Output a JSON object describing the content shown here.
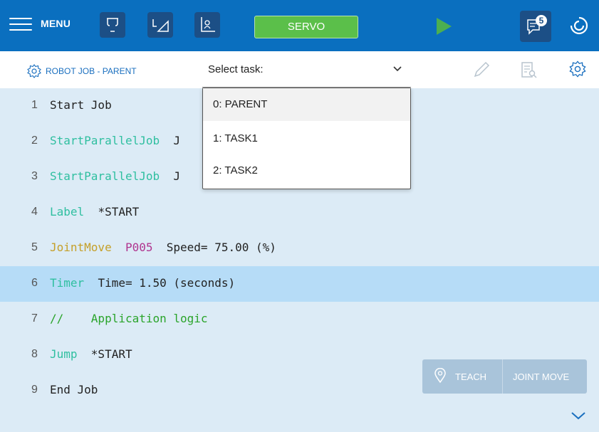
{
  "topbar": {
    "menu_label": "MENU",
    "servo_label": "SERVO",
    "message_count": "5",
    "colors": {
      "bar": "#0a6fbf",
      "tool_bg": "#1c4f86",
      "servo": "#5bbf4a",
      "play": "#4caf50"
    }
  },
  "subheader": {
    "job_title": "ROBOT JOB - PARENT",
    "task_select_label": "Select task:"
  },
  "dropdown": {
    "options": [
      "0: PARENT",
      "1: TASK1",
      "2: TASK2"
    ]
  },
  "program": {
    "lines": [
      {
        "num": "1",
        "segs": [
          {
            "t": "Start Job",
            "c": "plain"
          }
        ]
      },
      {
        "num": "2",
        "segs": [
          {
            "t": "StartParallelJob",
            "c": "kw"
          },
          {
            "t": "  J",
            "c": "plain"
          }
        ]
      },
      {
        "num": "3",
        "segs": [
          {
            "t": "StartParallelJob",
            "c": "kw"
          },
          {
            "t": "  J",
            "c": "plain"
          }
        ]
      },
      {
        "num": "4",
        "segs": [
          {
            "t": "Label",
            "c": "kw"
          },
          {
            "t": "  *START",
            "c": "plain"
          }
        ]
      },
      {
        "num": "5",
        "segs": [
          {
            "t": "JointMove",
            "c": "kwo"
          },
          {
            "t": "  ",
            "c": "plain"
          },
          {
            "t": "P005",
            "c": "var"
          },
          {
            "t": "  Speed= 75.00 (%)",
            "c": "plain"
          }
        ]
      },
      {
        "num": "6",
        "segs": [
          {
            "t": "Timer",
            "c": "kw"
          },
          {
            "t": "  Time= 1.50 (seconds)",
            "c": "plain"
          }
        ],
        "selected": true
      },
      {
        "num": "7",
        "segs": [
          {
            "t": "//    Application logic",
            "c": "cmt"
          }
        ]
      },
      {
        "num": "8",
        "segs": [
          {
            "t": "Jump",
            "c": "kw"
          },
          {
            "t": "  *START",
            "c": "plain"
          }
        ]
      },
      {
        "num": "9",
        "segs": [
          {
            "t": "End Job",
            "c": "plain"
          }
        ]
      }
    ]
  },
  "bottom": {
    "teach_label": "TEACH",
    "joint_move_label": "JOINT MOVE"
  }
}
